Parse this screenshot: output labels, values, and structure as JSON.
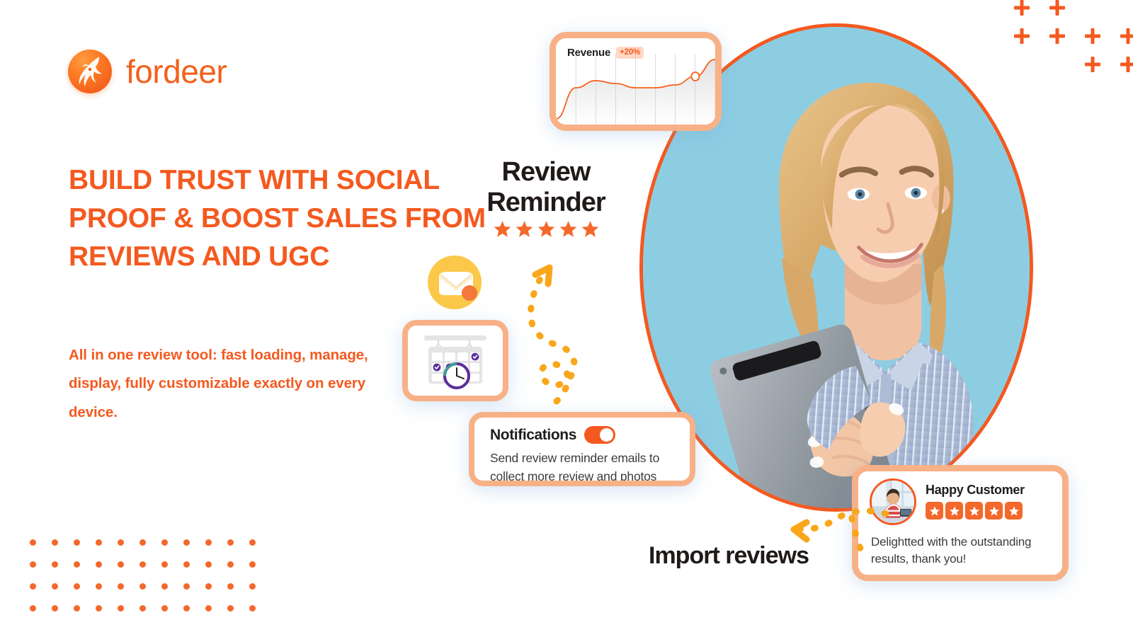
{
  "brand": {
    "name": "fordeer",
    "logo_icon": "deer-logo-icon",
    "accent_color": "#f4591f",
    "accent_secondary": "#f4682b"
  },
  "hero": {
    "headline": "BUILD TRUST WITH SOCIAL PROOF & BOOST SALES FROM REVIEWS AND UGC",
    "subheadline": "All in one review tool: fast loading, manage, display, fully customizable exactly on every device.",
    "photo_alt": "Smiling blonde woman in a blue striped shirt holding a tablet on a light blue background",
    "photo_background_color": "#8dcde2",
    "ring_color": "#f4591f"
  },
  "revenue_card": {
    "title": "Revenue",
    "badge": "+20%",
    "badge_color": "#f4591f",
    "badge_background": "#ffd9c6"
  },
  "chart_data": {
    "type": "area",
    "title": "Revenue",
    "annotation": "+20%",
    "xlabel": "",
    "ylabel": "",
    "grid": true,
    "legend_position": "none",
    "x": [
      0,
      1,
      2,
      3,
      4,
      5,
      6,
      7,
      8
    ],
    "values": [
      8,
      52,
      62,
      58,
      52,
      52,
      56,
      68,
      92
    ],
    "ylim": [
      0,
      100
    ],
    "highlight_point": {
      "x": 7,
      "y": 68
    },
    "line_color": "#f4601c",
    "fill": "#f0f0f0"
  },
  "reminder": {
    "line1": "Review",
    "line2": "Reminder",
    "star_count": 5,
    "star_color": "#f4682b"
  },
  "calendar_card": {
    "icon": "calendar-clock-icon",
    "checked_days": 3,
    "check_color": "#5b2d9b"
  },
  "notifications_card": {
    "title": "Notifications",
    "toggle_state": "on",
    "body": "Send review reminder emails to collect more review and photos"
  },
  "review_card": {
    "author": "Happy Customer",
    "rating": 5,
    "stars_total": 5,
    "text": "Delightted with the outstanding results, thank you!",
    "avatar_alt": "Woman in a red striped shirt working at a desk"
  },
  "import_label": "Import reviews",
  "decor": {
    "envelope_icon": "email-envelope-icon",
    "envelope_color": "#fcc849",
    "envelope_dot_color": "#f4783c",
    "arrow_up_icon": "curved-dashed-arrow-up-icon",
    "arrow_down_icon": "dashed-arrow-down-left-icon",
    "arrow_color": "#faa61a",
    "plus_color": "#f4591f",
    "plus_count": 8,
    "dot_color": "#f4682b",
    "dot_columns": 11,
    "dot_rows": 4
  }
}
